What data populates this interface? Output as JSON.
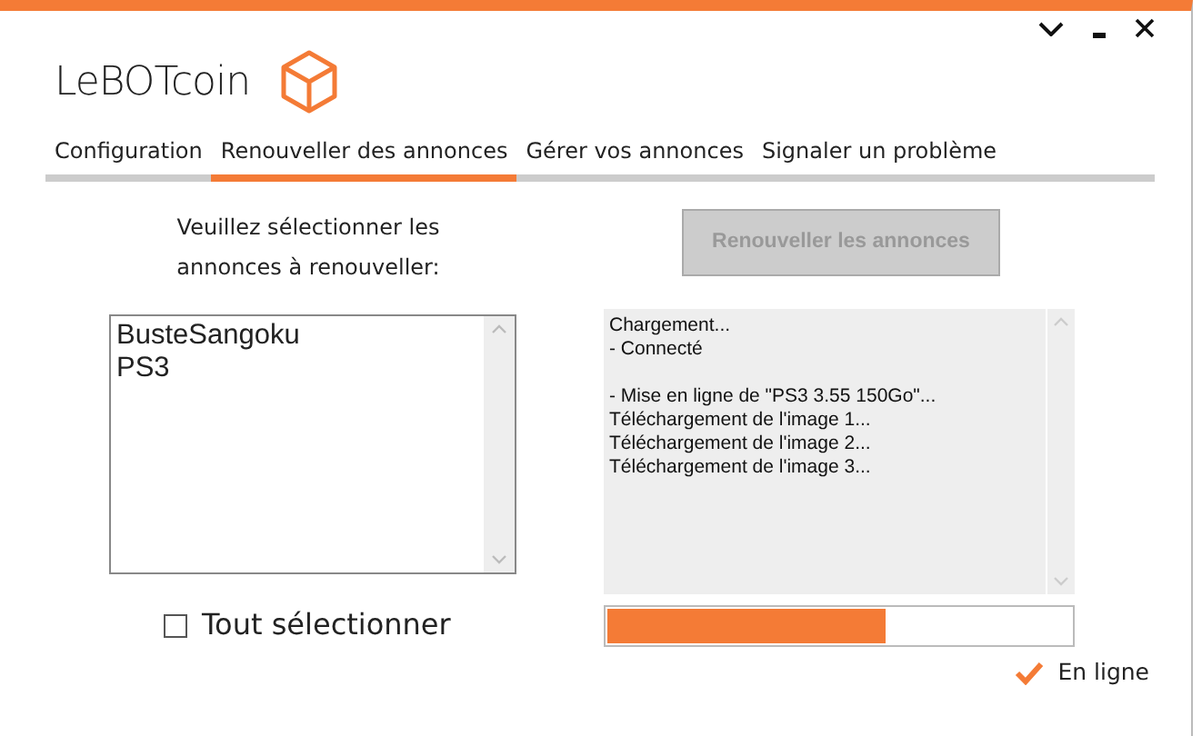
{
  "app": {
    "title": "LeBOTcoin"
  },
  "tabs": [
    {
      "label": "Configuration",
      "selected": false
    },
    {
      "label": "Renouveller des annonces",
      "selected": true
    },
    {
      "label": "Gérer vos annonces",
      "selected": false
    },
    {
      "label": "Signaler un problème",
      "selected": false
    }
  ],
  "instruction": "Veuillez sélectionner les annonces à renouveller:",
  "listings": [
    {
      "label": "BusteSangoku",
      "selected": false
    },
    {
      "label": "PS3",
      "selected": false
    }
  ],
  "select_all": {
    "label": "Tout sélectionner",
    "checked": false
  },
  "renew_button": {
    "label": "Renouveller les annonces",
    "disabled": true
  },
  "log": [
    [
      "Chargement...",
      "- Connecté"
    ],
    [
      "- Mise en ligne de \"PS3 3.55 150Go\"...",
      "Téléchargement de l'image 1...",
      "Téléchargement de l'image 2...",
      "Téléchargement de l'image 3..."
    ]
  ],
  "progress": {
    "level": 0.6
  },
  "status": {
    "label": "En ligne",
    "online": true
  }
}
